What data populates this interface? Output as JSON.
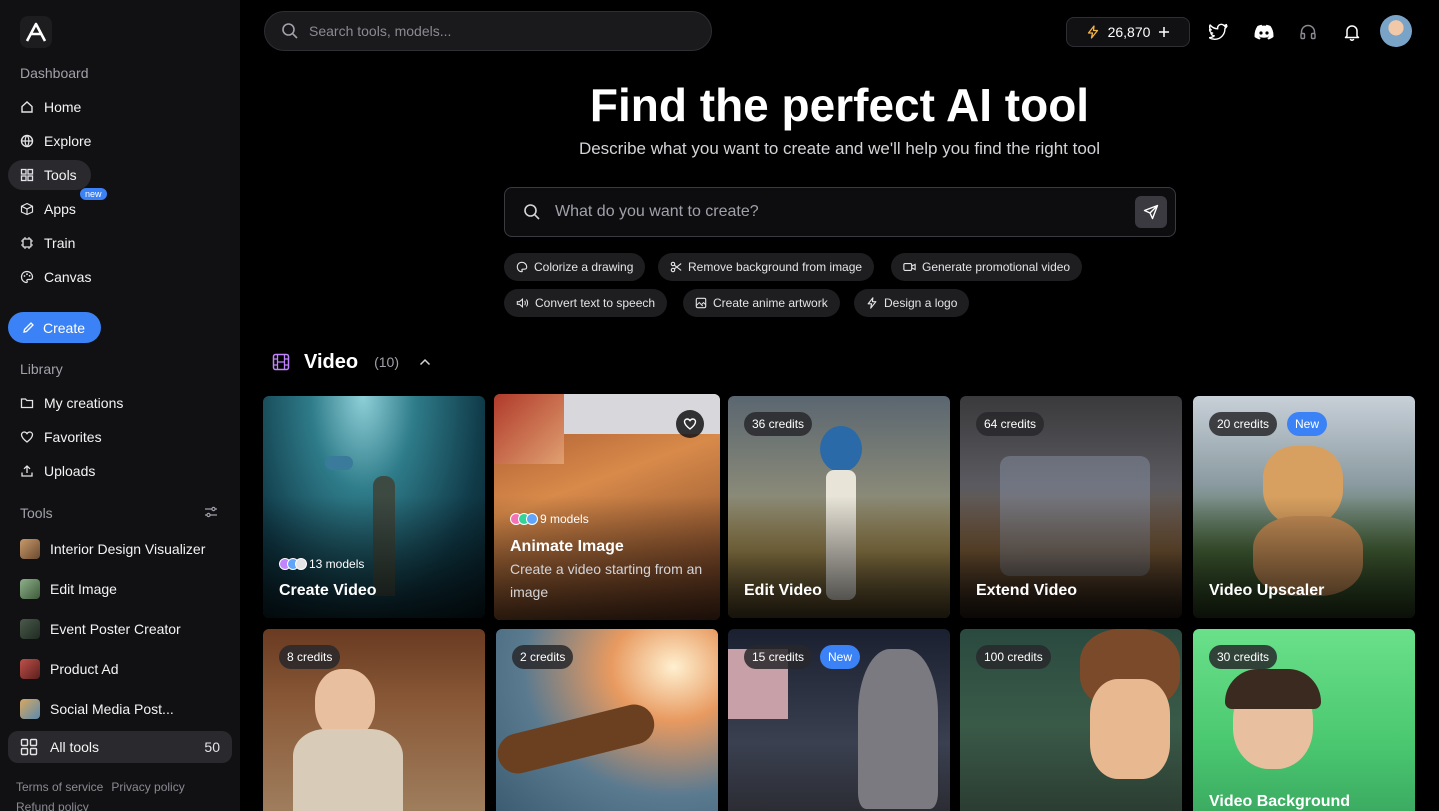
{
  "sidebar": {
    "dashboard_label": "Dashboard",
    "nav": [
      {
        "label": "Home",
        "icon": "home-icon"
      },
      {
        "label": "Explore",
        "icon": "globe-icon"
      },
      {
        "label": "Tools",
        "icon": "grid-icon"
      },
      {
        "label": "Apps",
        "icon": "box-icon",
        "badge": "new"
      },
      {
        "label": "Train",
        "icon": "chip-icon"
      },
      {
        "label": "Canvas",
        "icon": "palette-icon"
      }
    ],
    "create_label": "Create",
    "library_label": "Library",
    "library": [
      {
        "label": "My creations",
        "icon": "folder-icon"
      },
      {
        "label": "Favorites",
        "icon": "heart-icon"
      },
      {
        "label": "Uploads",
        "icon": "upload-icon"
      }
    ],
    "tools_label": "Tools",
    "tools": [
      {
        "label": "Interior Design Visualizer"
      },
      {
        "label": "Edit Image"
      },
      {
        "label": "Event Poster Creator"
      },
      {
        "label": "Product Ad"
      },
      {
        "label": "Social Media Post..."
      }
    ],
    "all_tools": {
      "label": "All tools",
      "count": "50"
    },
    "footer": {
      "terms": "Terms of service",
      "privacy": "Privacy policy",
      "refund": "Refund policy"
    }
  },
  "topbar": {
    "search_placeholder": "Search tools, models...",
    "credits": "26,870"
  },
  "hero": {
    "title": "Find the perfect AI tool",
    "subtitle": "Describe what you want to create and we'll help you find the right tool",
    "search_placeholder": "What do you want to create?",
    "chips": [
      {
        "label": "Colorize a drawing",
        "icon": "palette-icon"
      },
      {
        "label": "Remove background from image",
        "icon": "scissors-icon"
      },
      {
        "label": "Generate promotional video",
        "icon": "video-icon"
      },
      {
        "label": "Convert text to speech",
        "icon": "speaker-icon"
      },
      {
        "label": "Create anime artwork",
        "icon": "image-icon"
      },
      {
        "label": "Design a logo",
        "icon": "bolt-icon"
      }
    ]
  },
  "section": {
    "title": "Video",
    "count": "(10)"
  },
  "cards": [
    {
      "name": "Create Video",
      "models": "13 models"
    },
    {
      "name": "Animate Image",
      "models": "9 models",
      "desc": "Create a video starting from an image"
    },
    {
      "name": "Edit Video",
      "credits": "36 credits"
    },
    {
      "name": "Extend Video",
      "credits": "64 credits"
    },
    {
      "name": "Video Upscaler",
      "credits": "20 credits",
      "new": "New"
    },
    {
      "name": "",
      "credits": "8 credits"
    },
    {
      "name": "",
      "credits": "2 credits"
    },
    {
      "name": "",
      "credits": "15 credits",
      "new": "New"
    },
    {
      "name": "",
      "credits": "100 credits"
    },
    {
      "name": "Video Background",
      "credits": "30 credits"
    }
  ]
}
